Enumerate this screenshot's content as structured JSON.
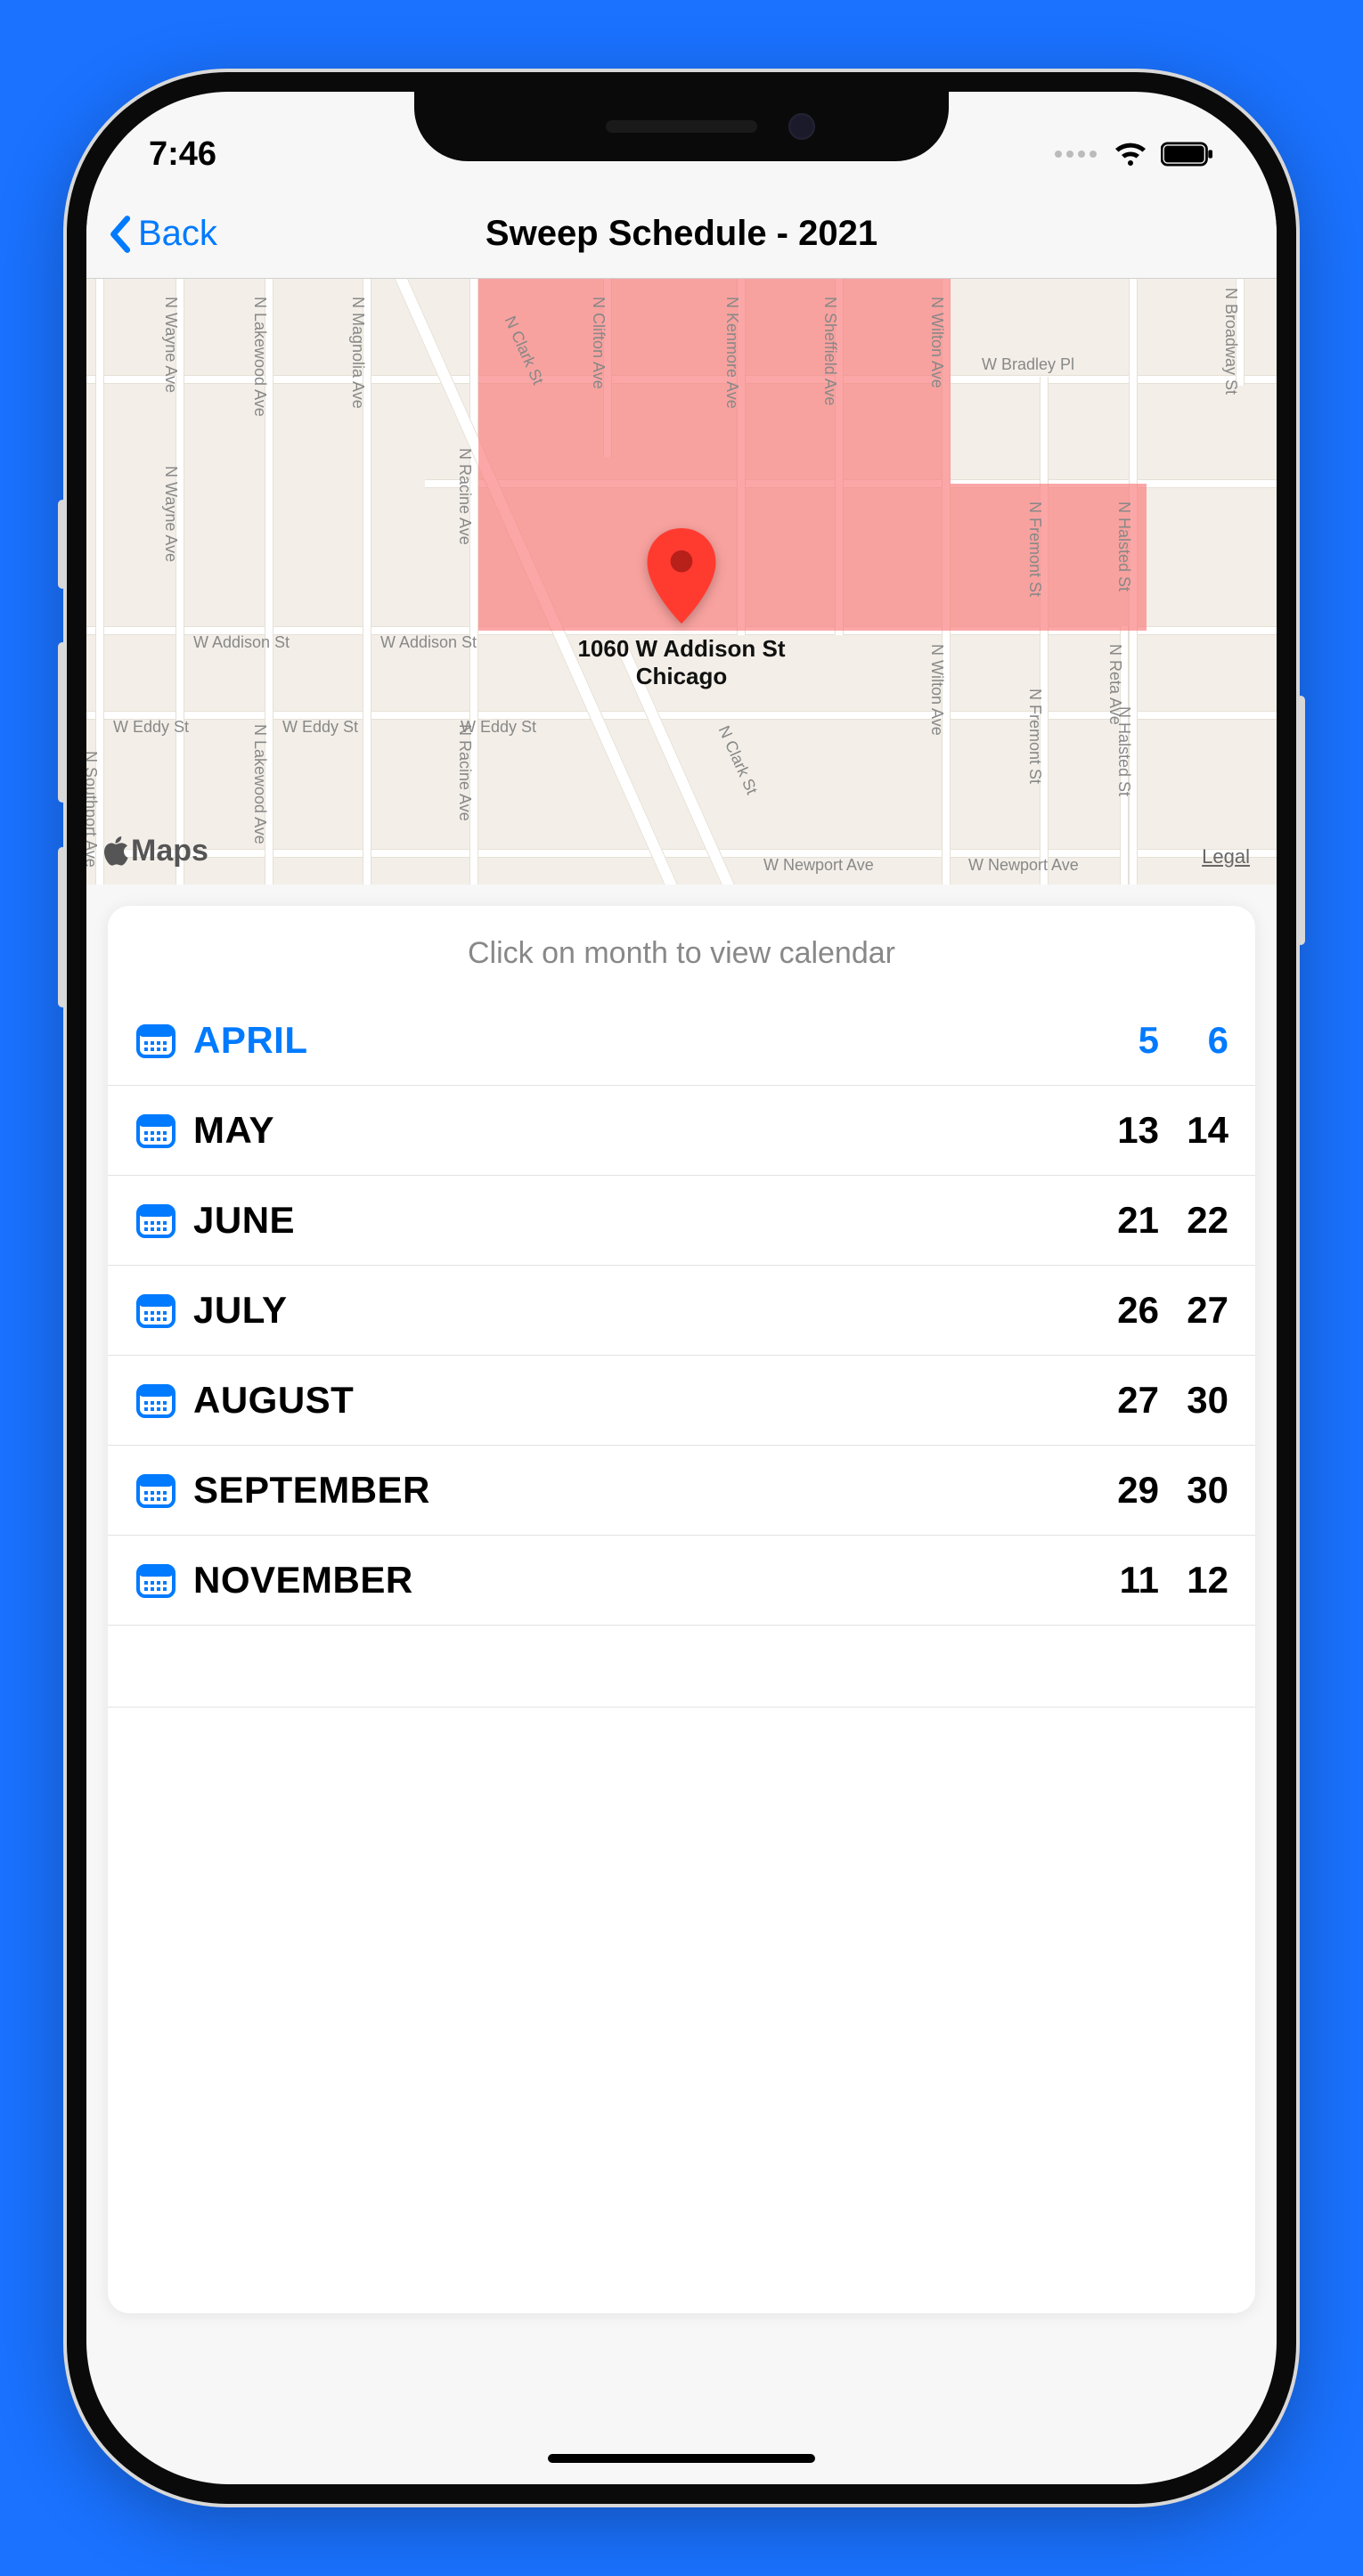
{
  "status": {
    "time": "7:46"
  },
  "nav": {
    "back_label": "Back",
    "title": "Sweep Schedule - 2021"
  },
  "map": {
    "pin_line1": "1060 W Addison St",
    "pin_line2": "Chicago",
    "attribution": "Maps",
    "legal": "Legal",
    "streets_h": {
      "bradley": "W Bradley Pl",
      "addison_1": "W Addison St",
      "addison_2": "W Addison St",
      "eddy_1": "W Eddy St",
      "eddy_2": "W Eddy St",
      "eddy_3": "W Eddy St",
      "newport_1": "W Newport Ave",
      "newport_2": "W Newport Ave"
    },
    "streets_v": {
      "southport": "N Southport Ave",
      "wayne_1": "N Wayne Ave",
      "wayne_2": "N Wayne Ave",
      "lakewood_1": "N Lakewood Ave",
      "lakewood_2": "N Lakewood Ave",
      "magnolia": "N Magnolia Ave",
      "racine_1": "N Racine Ave",
      "racine_2": "N Racine Ave",
      "clifton": "N Clifton Ave",
      "clark_1": "N Clark St",
      "clark_2": "N Clark St",
      "kenmore": "N Kenmore Ave",
      "sheffield": "N Sheffield Ave",
      "wilton_1": "N Wilton Ave",
      "wilton_2": "N Wilton Ave",
      "fremont_1": "N Fremont St",
      "fremont_2": "N Fremont St",
      "halsted_1": "N Halsted St",
      "halsted_2": "N Halsted St",
      "reta": "N Reta Ave",
      "broadway": "N Broadway St"
    }
  },
  "card": {
    "hint": "Click on month to view calendar",
    "months": [
      {
        "name": "APRIL",
        "d1": "5",
        "d2": "6",
        "active": true
      },
      {
        "name": "MAY",
        "d1": "13",
        "d2": "14",
        "active": false
      },
      {
        "name": "JUNE",
        "d1": "21",
        "d2": "22",
        "active": false
      },
      {
        "name": "JULY",
        "d1": "26",
        "d2": "27",
        "active": false
      },
      {
        "name": "AUGUST",
        "d1": "27",
        "d2": "30",
        "active": false
      },
      {
        "name": "SEPTEMBER",
        "d1": "29",
        "d2": "30",
        "active": false
      },
      {
        "name": "NOVEMBER",
        "d1": "11",
        "d2": "12",
        "active": false
      }
    ]
  }
}
